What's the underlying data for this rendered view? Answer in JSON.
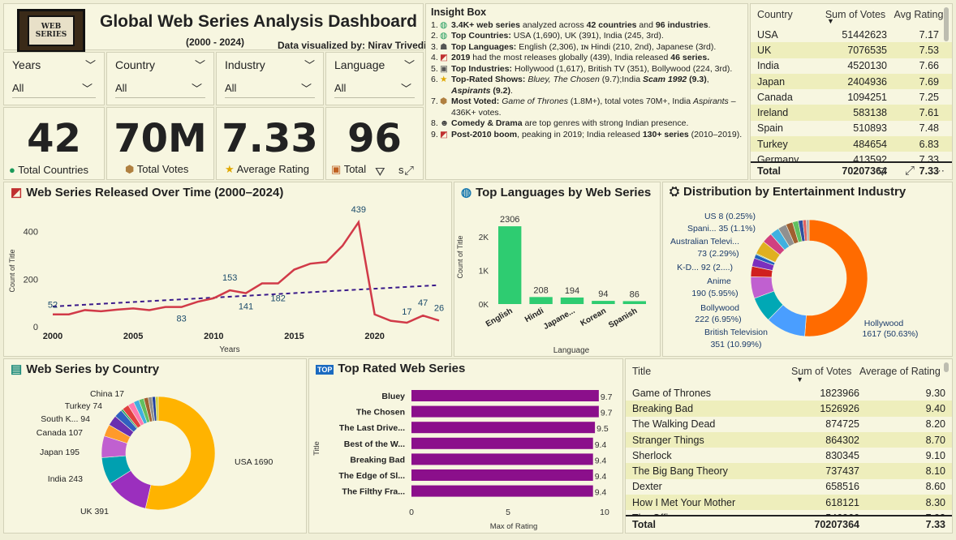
{
  "header": {
    "logo_text": "WEB SERIES",
    "title": "Global Web Series Analysis Dashboard",
    "subtitle": "(2000 - 2024)",
    "credit": "Data visualized by: Nirav Trivedi"
  },
  "filters": [
    {
      "label": "Years",
      "value": "All"
    },
    {
      "label": "Country",
      "value": "All"
    },
    {
      "label": "Industry",
      "value": "All"
    },
    {
      "label": "Language",
      "value": "All"
    }
  ],
  "kpis": [
    {
      "value": "42",
      "caption": "Total Countries",
      "icon": "globe-icon"
    },
    {
      "value": "70M",
      "caption": "Total  Votes",
      "icon": "box-icon"
    },
    {
      "value": "7.33",
      "caption": "Average Rating",
      "icon": "star-icon"
    },
    {
      "value": "96",
      "caption": "Total",
      "caption_tail": "s",
      "icon": "clapper-icon"
    }
  ],
  "insight": {
    "title": "Insight Box",
    "items": [
      {
        "n": "1.",
        "icon": "globe-icon",
        "html": "<b>3.4K+ web series</b> analyzed across <b>42 countries</b> and <b>96 industries</b>."
      },
      {
        "n": "2.",
        "icon": "globe-icon",
        "html": "<b>Top Countries:</b> USA (1,690), UK (391), India (245, 3rd)."
      },
      {
        "n": "3.",
        "icon": "speaker-icon",
        "html": "<b>Top Languages:</b> English (2,306), ɪɴ Hindi (210, 2nd), Japanese (3rd)."
      },
      {
        "n": "4.",
        "icon": "chart-icon",
        "html": "<b>2019</b> had the most releases globally (439), India released <b>46 series.</b>"
      },
      {
        "n": "5.",
        "icon": "film-icon",
        "html": "<b>Top Industries:</b> Hollywood (1,617), British TV (351), Bollywood (224, 3rd)."
      },
      {
        "n": "6.",
        "icon": "star-icon",
        "html": "<b>Top-Rated Shows:</b> <i>Bluey, The Chosen</i> (9.7);India <b><i>Scam 1992</i> (9.3)</b>, <b><i>Aspirants</i> (9.2)</b>."
      },
      {
        "n": "7.",
        "icon": "box-icon",
        "html": "<b>Most Voted:</b> <i>Game of Thrones</i> (1.8M+), total votes 70M+, India <i>Aspirants</i> – 436K+ votes."
      },
      {
        "n": "8.",
        "icon": "masks-icon",
        "html": "<b>Comedy &amp; Drama</b> are top genres with strong Indian presence."
      },
      {
        "n": "9.",
        "icon": "chart-icon",
        "html": "<b>Post-2010 boom</b>, peaking in 2019; India released <b>130+ series</b> (2010–2019)."
      }
    ]
  },
  "country_table": {
    "headers": [
      "Country",
      "Sum of Votes",
      "Avg Rating"
    ],
    "rows": [
      [
        "USA",
        "51442623",
        "7.17"
      ],
      [
        "UK",
        "7076535",
        "7.53"
      ],
      [
        "India",
        "4520130",
        "7.66"
      ],
      [
        "Japan",
        "2404936",
        "7.69"
      ],
      [
        "Canada",
        "1094251",
        "7.25"
      ],
      [
        "Ireland",
        "583138",
        "7.61"
      ],
      [
        "Spain",
        "510893",
        "7.48"
      ],
      [
        "Turkey",
        "484654",
        "6.83"
      ],
      [
        "Germany",
        "413592",
        "7.33"
      ]
    ],
    "total": [
      "Total",
      "70207364",
      "7.33"
    ]
  },
  "panels": {
    "line_title": "Web Series Released Over Time (2000–2024)",
    "lang_title": "Top Languages by Web Series",
    "industry_title": "Distribution by Entertainment Industry",
    "country_title": "Web Series by Country",
    "rated_title": "Top Rated Web Series"
  },
  "title_table": {
    "headers": [
      "Title",
      "Sum of Votes",
      "Average of Rating"
    ],
    "rows": [
      [
        "Game of Thrones",
        "1823966",
        "9.30"
      ],
      [
        "Breaking Bad",
        "1526926",
        "9.40"
      ],
      [
        "The Walking Dead",
        "874725",
        "8.20"
      ],
      [
        "Stranger Things",
        "864302",
        "8.70"
      ],
      [
        "Sherlock",
        "830345",
        "9.10"
      ],
      [
        "The Big Bang Theory",
        "737437",
        "8.10"
      ],
      [
        "Dexter",
        "658516",
        "8.60"
      ],
      [
        "How I Met Your Mother",
        "618121",
        "8.30"
      ],
      [
        "The Office",
        "546966",
        "7.93"
      ]
    ],
    "total": [
      "Total",
      "70207364",
      "7.33"
    ]
  },
  "chart_data": [
    {
      "type": "line",
      "title": "Web Series Released Over Time (2000–2024)",
      "xlabel": "Years",
      "ylabel": "Count of Title",
      "x_ticks": [
        2000,
        2005,
        2010,
        2015,
        2020
      ],
      "y_ticks": [
        0,
        200,
        400
      ],
      "ylim": [
        0,
        470
      ],
      "xlim": [
        2000,
        2024
      ],
      "x": [
        2000,
        2001,
        2002,
        2003,
        2004,
        2005,
        2006,
        2007,
        2008,
        2009,
        2010,
        2011,
        2012,
        2013,
        2014,
        2015,
        2016,
        2017,
        2018,
        2019,
        2020,
        2021,
        2022,
        2023,
        2024
      ],
      "values": [
        52,
        52,
        70,
        65,
        72,
        77,
        70,
        83,
        83,
        105,
        120,
        153,
        141,
        182,
        182,
        240,
        265,
        272,
        340,
        439,
        52,
        25,
        17,
        47,
        26
      ],
      "data_labels": [
        {
          "year": 2000,
          "value": 52,
          "text": "52"
        },
        {
          "year": 2008,
          "value": 83,
          "text": "83"
        },
        {
          "year": 2011,
          "value": 153,
          "text": "153"
        },
        {
          "year": 2012,
          "value": 141,
          "text": "141"
        },
        {
          "year": 2014,
          "value": 182,
          "text": "182"
        },
        {
          "year": 2019,
          "value": 439,
          "text": "439"
        },
        {
          "year": 2022,
          "value": 17,
          "text": "17"
        },
        {
          "year": 2023,
          "value": 47,
          "text": "47"
        },
        {
          "year": 2024,
          "value": 26,
          "text": "26"
        }
      ],
      "trend": [
        85,
        175
      ],
      "colors": {
        "line": "#d13a48",
        "trend": "#3a1a8a"
      }
    },
    {
      "type": "bar",
      "title": "Top Languages by Web Series",
      "xlabel": "Language",
      "ylabel": "Count of Title",
      "categories": [
        "English",
        "Hindi",
        "Japane...",
        "Korean",
        "Spanish"
      ],
      "values": [
        2306,
        208,
        194,
        94,
        86
      ],
      "y_ticks": [
        "0K",
        "1K",
        "2K"
      ],
      "ylim": [
        0,
        2500
      ],
      "color": "#2ecc71"
    },
    {
      "type": "pie",
      "title": "Distribution by Entertainment Industry",
      "slices": [
        {
          "label": "Hollywood",
          "value": 1617,
          "pct": "50.63%",
          "color": "#ff6b00"
        },
        {
          "label": "British Television",
          "value": 351,
          "pct": "10.99%",
          "color": "#4a9eff"
        },
        {
          "label": "Bollywood",
          "value": 222,
          "pct": "6.95%",
          "color": "#00a8b5"
        },
        {
          "label": "Anime",
          "value": 190,
          "pct": "5.95%",
          "color": "#c060d0"
        },
        {
          "label": "K-D...",
          "value": 92,
          "pct": "2....",
          "color": "#d02020"
        },
        {
          "label": "Australian Televi...",
          "value": 73,
          "pct": "2.29%",
          "color": "#7b2fbe"
        },
        {
          "label": "Spani...",
          "value": 35,
          "pct": "1.1%",
          "color": "#2060c0"
        },
        {
          "label": "US",
          "value": 8,
          "pct": "0.25%",
          "color": "#20a060"
        },
        {
          "label": "",
          "value": 120,
          "pct": "",
          "color": "#e0b020"
        },
        {
          "label": "",
          "value": 90,
          "pct": "",
          "color": "#d04080"
        },
        {
          "label": "",
          "value": 80,
          "pct": "",
          "color": "#40b0e0"
        },
        {
          "label": "",
          "value": 75,
          "pct": "",
          "color": "#909090"
        },
        {
          "label": "",
          "value": 60,
          "pct": "",
          "color": "#a06030"
        },
        {
          "label": "",
          "value": 50,
          "pct": "",
          "color": "#60c060"
        },
        {
          "label": "",
          "value": 40,
          "pct": "",
          "color": "#3050a0"
        },
        {
          "label": "",
          "value": 30,
          "pct": "",
          "color": "#e06060"
        },
        {
          "label": "",
          "value": 25,
          "pct": "",
          "color": "#b0b0b0"
        }
      ],
      "labels_text": [
        "US 8 (0.25%)",
        "Spani... 35 (1.1%)",
        "Australian Televi...",
        "73 (2.29%)",
        "K-D... 92 (2....)",
        "Anime",
        "190 (5.95%)",
        "Bollywood",
        "222 (6.95%)",
        "British Television",
        "351 (10.99%)",
        "Hollywood",
        "1617 (50.63%)"
      ]
    },
    {
      "type": "pie",
      "title": "Web Series by Country",
      "slices": [
        {
          "label": "USA",
          "value": 1690,
          "color": "#ffb300"
        },
        {
          "label": "UK",
          "value": 391,
          "color": "#9b2fbe"
        },
        {
          "label": "India",
          "value": 243,
          "color": "#00a0b0"
        },
        {
          "label": "Japan",
          "value": 195,
          "color": "#c060d0"
        },
        {
          "label": "Canada",
          "value": 107,
          "color": "#ff9a2a"
        },
        {
          "label": "South K...",
          "value": 94,
          "color": "#6a2fb0"
        },
        {
          "label": "Turkey",
          "value": 74,
          "color": "#3060c0"
        },
        {
          "label": "China",
          "value": 17,
          "color": "#20a060"
        },
        {
          "label": "",
          "value": 60,
          "color": "#e04040"
        },
        {
          "label": "",
          "value": 55,
          "color": "#ff7ab0"
        },
        {
          "label": "",
          "value": 50,
          "color": "#40b0e0"
        },
        {
          "label": "",
          "value": 45,
          "color": "#60c060"
        },
        {
          "label": "",
          "value": 40,
          "color": "#a06030"
        },
        {
          "label": "",
          "value": 35,
          "color": "#909090"
        },
        {
          "label": "",
          "value": 30,
          "color": "#2040a0"
        },
        {
          "label": "",
          "value": 25,
          "color": "#d0d040"
        }
      ],
      "labels_text": [
        "China 17",
        "Turkey 74",
        "South K... 94",
        "Canada 107",
        "Japan 195",
        "India 243",
        "UK 391",
        "USA 1690"
      ]
    },
    {
      "type": "bar",
      "orientation": "horizontal",
      "title": "Top Rated Web Series",
      "xlabel": "Max of Rating",
      "ylabel": "Title",
      "categories": [
        "Bluey",
        "The Chosen",
        "The Last Drive...",
        "Best of the W...",
        "Breaking Bad",
        "The Edge of Sl...",
        "The Filthy Fra..."
      ],
      "values": [
        9.7,
        9.7,
        9.5,
        9.4,
        9.4,
        9.4,
        9.4
      ],
      "value_labels": [
        "9.7",
        "9.7",
        "9.5",
        "9.4",
        "9.4",
        "9.4",
        "9.4"
      ],
      "x_ticks": [
        0,
        5,
        10
      ],
      "xlim": [
        0,
        10
      ],
      "color": "#8b0f8b"
    }
  ]
}
